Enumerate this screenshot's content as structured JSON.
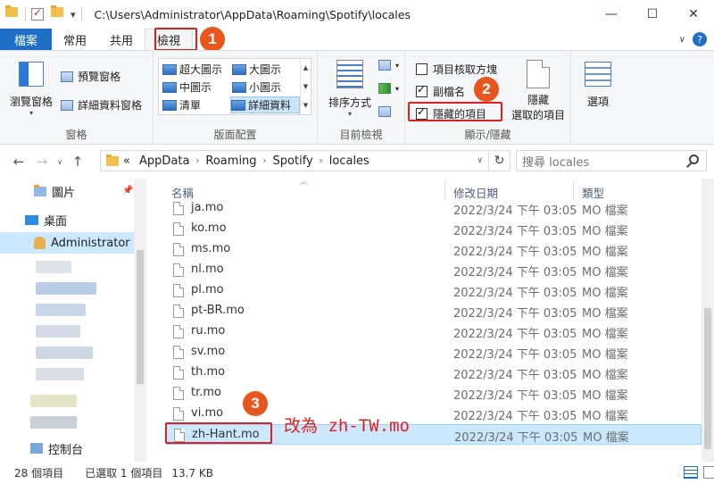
{
  "titlebar": {
    "path": "C:\\Users\\Administrator\\AppData\\Roaming\\Spotify\\locales",
    "qa_dropdown": "▾",
    "minimize": "—",
    "maximize": "☐",
    "close": "✕"
  },
  "tabs": {
    "file": "檔案",
    "home": "常用",
    "share": "共用",
    "view": "檢視"
  },
  "ribbon": {
    "panes": {
      "nav_pane": "瀏覽窗格",
      "preview_pane": "預覽窗格",
      "details_pane": "詳細資料窗格",
      "label": "窗格"
    },
    "layout": {
      "extra_large": "超大圖示",
      "large": "大圖示",
      "medium": "中圖示",
      "small": "小圖示",
      "list": "清單",
      "details": "詳細資料",
      "label": "版面配置"
    },
    "current_view": {
      "sort_by": "排序方式",
      "label": "目前檢視"
    },
    "show_hide": {
      "item_checkboxes": "項目核取方塊",
      "file_extensions": "副檔名",
      "hidden_items": "隱藏的項目",
      "hide_selected_line1": "隱藏",
      "hide_selected_line2": "選取的項目",
      "label": "顯示/隱藏"
    },
    "options": "選項"
  },
  "address": {
    "crumbs": [
      "AppData",
      "Roaming",
      "Spotify",
      "locales"
    ],
    "overflow": "«",
    "search_placeholder": "搜尋 locales"
  },
  "nav": {
    "pictures": "圖片",
    "desktop": "桌面",
    "administrator": "Administrator",
    "partial": "控制台"
  },
  "columns": {
    "name": "名稱",
    "date": "修改日期",
    "type": "類型"
  },
  "files": [
    {
      "name": "ja.mo",
      "date": "2022/3/24 下午 03:05",
      "type": "MO 檔案"
    },
    {
      "name": "ko.mo",
      "date": "2022/3/24 下午 03:05",
      "type": "MO 檔案"
    },
    {
      "name": "ms.mo",
      "date": "2022/3/24 下午 03:05",
      "type": "MO 檔案"
    },
    {
      "name": "nl.mo",
      "date": "2022/3/24 下午 03:05",
      "type": "MO 檔案"
    },
    {
      "name": "pl.mo",
      "date": "2022/3/24 下午 03:05",
      "type": "MO 檔案"
    },
    {
      "name": "pt-BR.mo",
      "date": "2022/3/24 下午 03:05",
      "type": "MO 檔案"
    },
    {
      "name": "ru.mo",
      "date": "2022/3/24 下午 03:05",
      "type": "MO 檔案"
    },
    {
      "name": "sv.mo",
      "date": "2022/3/24 下午 03:05",
      "type": "MO 檔案"
    },
    {
      "name": "th.mo",
      "date": "2022/3/24 下午 03:05",
      "type": "MO 檔案"
    },
    {
      "name": "tr.mo",
      "date": "2022/3/24 下午 03:05",
      "type": "MO 檔案"
    },
    {
      "name": "vi.mo",
      "date": "2022/3/24 下午 03:05",
      "type": "MO 檔案"
    },
    {
      "name": "zh-Hant.mo",
      "date": "2022/3/24 下午 03:05",
      "type": "MO 檔案"
    }
  ],
  "annotations": {
    "step1": "1",
    "step2": "2",
    "step3": "3",
    "rename_note": "改為 zh-TW.mo"
  },
  "status": {
    "count": "28 個項目",
    "selected": "已選取 1 個項目",
    "size": "13.7 KB"
  },
  "colors": {
    "accent": "#1f6fc6",
    "annotation_red": "#e02020",
    "badge_orange": "#e8551d",
    "selection": "#cce8ff"
  }
}
